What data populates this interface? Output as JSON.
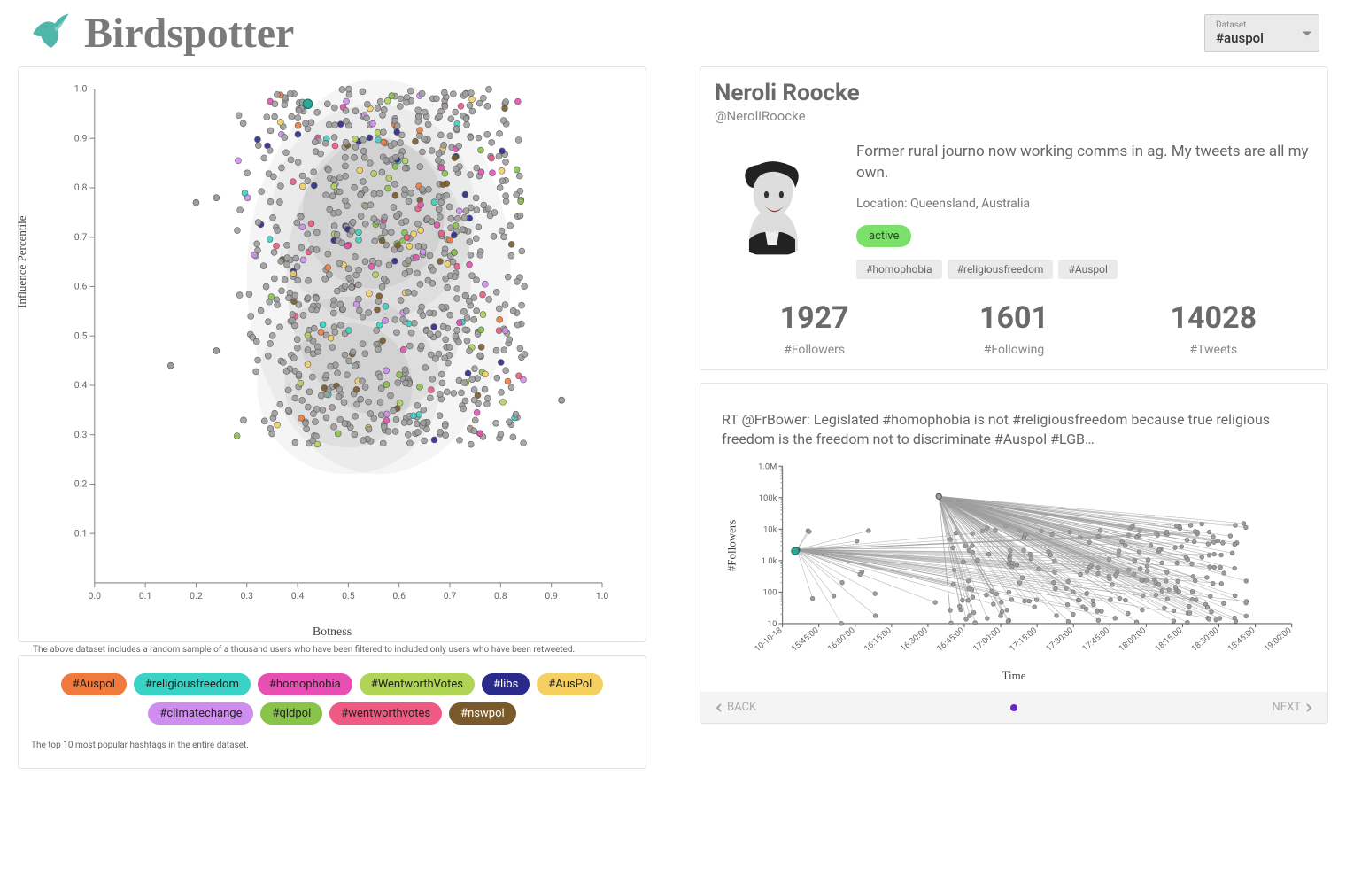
{
  "app": {
    "title": "Birdspotter"
  },
  "dataset_selector": {
    "label": "Dataset",
    "value": "#auspol"
  },
  "chart_data": {
    "type": "scatter",
    "title": "",
    "xlabel": "Botness",
    "ylabel": "Influence Percentile",
    "xlim": [
      0.0,
      1.0
    ],
    "ylim": [
      0.0,
      1.0
    ],
    "xticks": [
      0.0,
      0.1,
      0.2,
      0.3,
      0.4,
      0.5,
      0.6,
      0.7,
      0.8,
      0.9,
      1.0
    ],
    "yticks": [
      0.1,
      0.2,
      0.3,
      0.4,
      0.5,
      0.6,
      0.7,
      0.8,
      0.9,
      1.0
    ],
    "note": "~1000 points densely distributed mostly in x∈[0.3,0.85], y∈[0.28,1.0]; a few outliers near x≈0.15–0.25 and x≈0.92; points colored grey by default with subset colored by top hashtags (see legend)."
  },
  "scatter_footnote": "The above dataset includes a random sample of a thousand users who have been filtered to included only users who have been retweeted.",
  "hashtags_panel": {
    "footnote": "The top 10 most popular hashtags in the entire dataset.",
    "items": [
      {
        "label": "#Auspol",
        "color": "#f07a3c"
      },
      {
        "label": "#religiousfreedom",
        "color": "#38d3c4"
      },
      {
        "label": "#homophobia",
        "color": "#e84fb3"
      },
      {
        "label": "#WentworthVotes",
        "color": "#b0d456"
      },
      {
        "label": "#libs",
        "color": "#2a2a8a"
      },
      {
        "label": "#AusPol",
        "color": "#f5d060"
      },
      {
        "label": "#climatechange",
        "color": "#cf8df0"
      },
      {
        "label": "#qldpol",
        "color": "#88c34a"
      },
      {
        "label": "#wentworthvotes",
        "color": "#ef5a82"
      },
      {
        "label": "#nswpol",
        "color": "#7a5a2a"
      }
    ]
  },
  "profile": {
    "name": "Neroli Roocke",
    "handle": "@NeroliRoocke",
    "bio": "Former rural journo now working comms in ag. My tweets are all my own.",
    "location_label": "Location:",
    "location": "Queensland, Australia",
    "status": "active",
    "tags": [
      "#homophobia",
      "#religiousfreedom",
      "#Auspol"
    ],
    "stats": [
      {
        "value": "1927",
        "label": "#Followers"
      },
      {
        "value": "1601",
        "label": "#Following"
      },
      {
        "value": "14028",
        "label": "#Tweets"
      }
    ]
  },
  "cascade": {
    "tweet_text": "RT @FrBower: Legislated #homophobia is not #religiousfreedom because true religious freedom is the freedom not to discriminate #Auspol #LGB…",
    "xlabel": "Time",
    "ylabel": "#Followers",
    "yticks": [
      "10",
      "100",
      "1.0k",
      "10k",
      "100k",
      "1.0M"
    ],
    "xticks": [
      "10-10-18",
      "15:45:00",
      "16:00:00",
      "16:15:00",
      "16:30:00",
      "16:45:00",
      "17:00:00",
      "17:15:00",
      "17:30:00",
      "17:45:00",
      "18:00:00",
      "18:15:00",
      "18:30:00",
      "18:45:00",
      "19:00:00"
    ]
  },
  "pager": {
    "back": "BACK",
    "next": "NEXT"
  }
}
